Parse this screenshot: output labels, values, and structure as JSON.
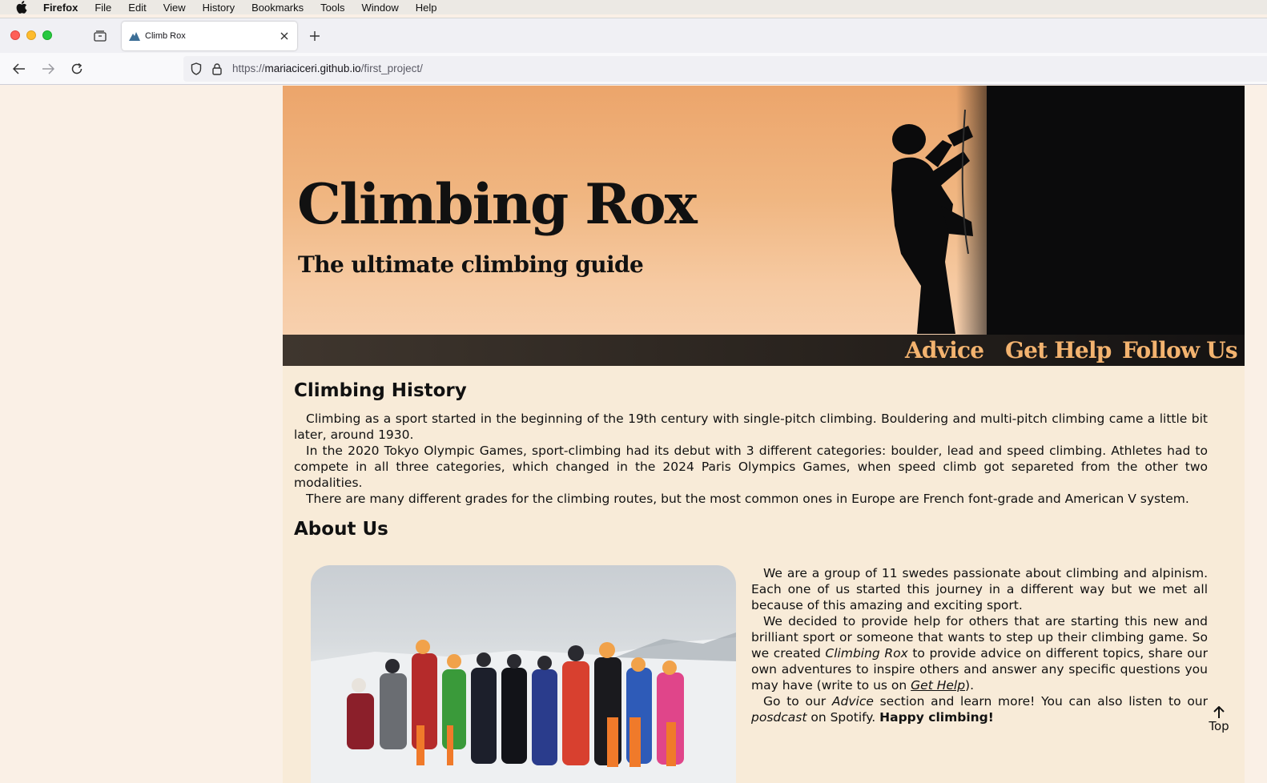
{
  "menubar": {
    "app": "Firefox",
    "items": [
      "File",
      "Edit",
      "View",
      "History",
      "Bookmarks",
      "Tools",
      "Window",
      "Help"
    ]
  },
  "browser": {
    "tab_title": "Climb Rox",
    "url_scheme": "https://",
    "url_host": "mariaciceri.github.io",
    "url_path": "/first_project/"
  },
  "site": {
    "title": "Climbing Rox",
    "subtitle": "The ultimate climbing guide",
    "nav": [
      "Advice",
      "Get Help",
      "Follow Us"
    ]
  },
  "history": {
    "heading": "Climbing History",
    "paragraphs": [
      "Climbing as a sport started in the beginning of the 19th century with single-pitch climbing. Bouldering and multi-pitch climbing came a little bit later, around 1930.",
      "In the 2020 Tokyo Olympic Games, sport-climbing had its debut with 3 different categories: boulder, lead and speed climbing. Athletes had to compete in all three categories, which changed in the 2024 Paris Olympics Games, when speed climb got separeted from the other two modalities.",
      "There are many different grades for the climbing routes, but the most common ones in Europe are French font-grade and American V system."
    ]
  },
  "about": {
    "heading": "About Us",
    "p1": "We are a group of 11 swedes passionate about climbing and alpinism. Each one of us started this journey in a different way but we met all because of this amazing and exciting sport.",
    "p2_a": "We decided to provide help for others that are starting this new and brilliant sport or someone that wants to step up their climbing game. So we created ",
    "p2_em": "Climbing Rox",
    "p2_b": " to provide advice on different topics, share our own adventures to inspire others and answer any specific questions you may have (write to us on ",
    "p2_link": "Get Help",
    "p2_c": ").",
    "p3_a": "Go to our ",
    "p3_em1": "Advice",
    "p3_b": " section and learn more! You can also listen to our ",
    "p3_em2": "posdcast",
    "p3_c": " on Spotify. ",
    "p3_strong": "Happy climbing!"
  },
  "top_button": {
    "label": "Top"
  },
  "colors": {
    "nav_link": "#f3b36f",
    "page_bg": "#f8ebd8",
    "hero_sky": "#eca56b"
  },
  "icons": [
    "apple-icon",
    "tab-list-icon",
    "mountain-favicon-icon",
    "close-icon",
    "plus-icon",
    "back-arrow-icon",
    "forward-arrow-icon",
    "reload-icon",
    "shield-icon",
    "lock-icon",
    "arrow-up-icon"
  ]
}
